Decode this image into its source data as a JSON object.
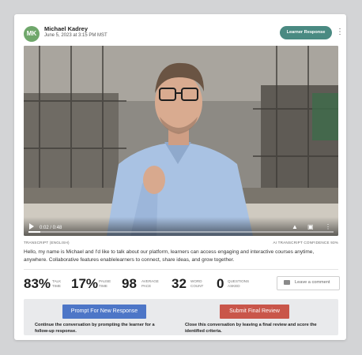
{
  "header": {
    "avatar_initials": "MK",
    "user_name": "Michael Kadrey",
    "date": "June 5, 2023 at 3:15 PM MST",
    "learner_response_label": "Learner Response",
    "menu_icon": "kebab-icon"
  },
  "video": {
    "current_time": "0:02",
    "duration": "0:48",
    "time_display": "0:02 / 0:48",
    "progress_fraction": 0.04,
    "icons": [
      "play-icon",
      "volume-icon",
      "fullscreen-icon",
      "more-icon"
    ]
  },
  "transcript": {
    "label": "TRANSCRIPT (ENGLISH)",
    "confidence_label": "AI TRANSCRIPT CONFIDENCE 93%",
    "text": "Hello, my name is Michael and I'd like to talk about our platform, learners can access engaging and interactive courses anytime, anywhere. Collaborative features enablelearners to connect, share ideas, and grow together."
  },
  "stats": [
    {
      "value": "83%",
      "label_line1": "TALK",
      "label_line2": "TIME"
    },
    {
      "value": "17%",
      "label_line1": "PAUSE",
      "label_line2": "TIME"
    },
    {
      "value": "98",
      "label_line1": "AVERAGE",
      "label_line2": "PACE"
    },
    {
      "value": "32",
      "label_line1": "WORD",
      "label_line2": "COUNT"
    },
    {
      "value": "0",
      "label_line1": "QUESTIONS",
      "label_line2": "ASKED"
    }
  ],
  "comment": {
    "label": "Leave a comment",
    "icon": "comment-icon"
  },
  "actions": {
    "prompt_button": "Prompt For New Response",
    "prompt_desc_line1": "Continue the conversation by prompting the learner for a",
    "prompt_desc_line2": "follow-up response.",
    "final_button": "Submit Final Review",
    "final_desc_line1": "Close this conversation by leaving a final review and score the",
    "final_desc_line2": "identified criteria."
  }
}
